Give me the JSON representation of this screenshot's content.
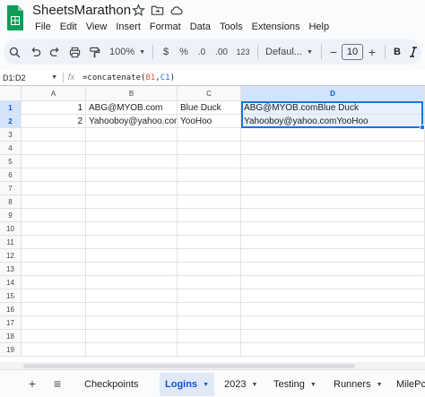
{
  "app": {
    "title": "SheetsMarathon",
    "menu": [
      "File",
      "Edit",
      "View",
      "Insert",
      "Format",
      "Data",
      "Tools",
      "Extensions",
      "Help"
    ]
  },
  "toolbar": {
    "zoom": "100%",
    "currency": "$",
    "percent": "%",
    "decrease_decimal": ".0",
    "increase_decimal": ".00",
    "number_format": "123",
    "font": "Defaul...",
    "font_size": "10",
    "minus": "−",
    "plus": "+",
    "bold": "B"
  },
  "formula_bar": {
    "name_box": "D1:D2",
    "fx": "fx",
    "formula_prefix": "=concatenate(",
    "formula_ref1": "B1",
    "formula_sep": ",",
    "formula_ref2": "C1",
    "formula_suffix": ")"
  },
  "grid": {
    "columns": [
      "A",
      "B",
      "C",
      "D"
    ],
    "rows": [
      "1",
      "2",
      "3",
      "4",
      "5",
      "6",
      "7",
      "8",
      "9",
      "10",
      "11",
      "12",
      "13",
      "14",
      "15",
      "16",
      "17",
      "18",
      "19"
    ],
    "cells": {
      "A1": "1",
      "B1": "ABG@MYOB.com",
      "C1": "Blue Duck",
      "D1": "ABG@MYOB.comBlue Duck",
      "A2": "2",
      "B2": "Yahooboy@yahoo.com",
      "C2": "YooHoo",
      "D2": "Yahooboy@yahoo.comYooHoo"
    }
  },
  "sheet_tabs": {
    "add": "+",
    "all_sheets": "≡",
    "tabs": [
      "Checkpoints",
      "Logins",
      "2023",
      "Testing",
      "Runners",
      "MilePc"
    ],
    "active_tab": "Logins"
  },
  "colors": {
    "accent": "#1a73e8",
    "selection_fill": "#e8f0fe",
    "header_selected": "#d3e3fd",
    "logo_green": "#0f9d58"
  },
  "icons": [
    "sheets-logo-icon",
    "star-icon",
    "move-folder-icon",
    "cloud-status-icon",
    "search-icon",
    "undo-icon",
    "redo-icon",
    "print-icon",
    "paint-format-icon",
    "chevron-down-icon"
  ]
}
